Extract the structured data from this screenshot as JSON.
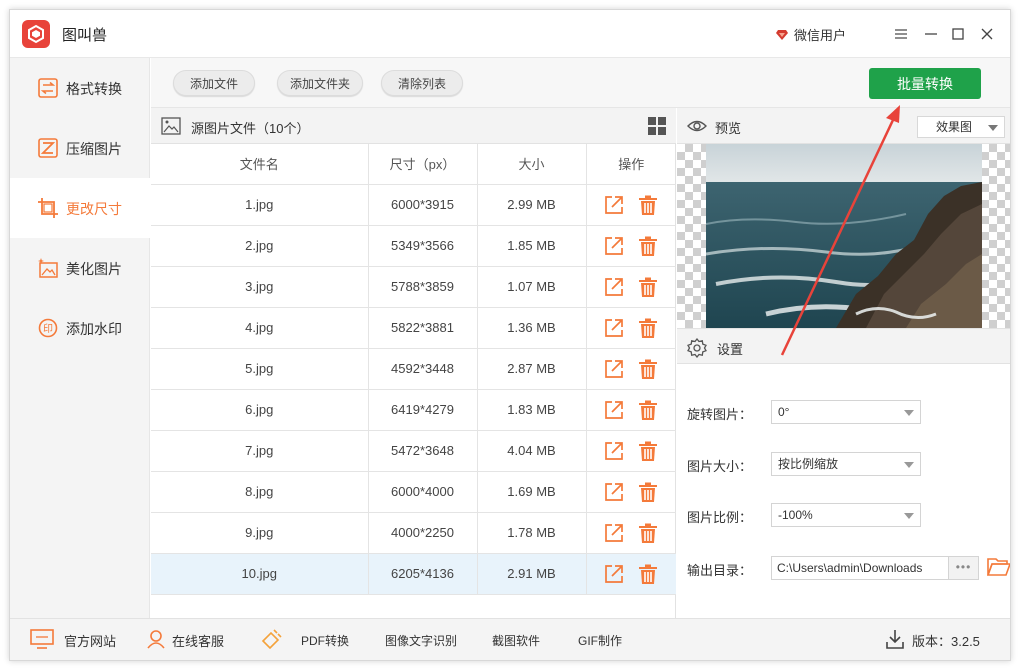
{
  "app": {
    "title": "图叫兽",
    "user_label": "微信用户"
  },
  "window_controls": {
    "menu": "☰",
    "minimize": "—",
    "maximize": "☐",
    "close": "✕"
  },
  "sidebar": {
    "items": [
      {
        "label": "格式转换",
        "icon": "swap-icon"
      },
      {
        "label": "压缩图片",
        "icon": "compress-icon"
      },
      {
        "label": "更改尺寸",
        "icon": "crop-icon",
        "active": true
      },
      {
        "label": "美化图片",
        "icon": "sparkle-image-icon"
      },
      {
        "label": "添加水印",
        "icon": "stamp-icon"
      }
    ]
  },
  "toolbar": {
    "add_file": "添加文件",
    "add_folder": "添加文件夹",
    "clear_list": "清除列表",
    "batch_convert": "批量转换"
  },
  "file_list": {
    "title": "源图片文件（10个）",
    "columns": [
      "文件名",
      "尺寸（px）",
      "大小",
      "操作"
    ],
    "rows": [
      {
        "name": "1.jpg",
        "size_px": "6000*3915",
        "filesize": "2.99 MB"
      },
      {
        "name": "2.jpg",
        "size_px": "5349*3566",
        "filesize": "1.85 MB"
      },
      {
        "name": "3.jpg",
        "size_px": "5788*3859",
        "filesize": "1.07 MB"
      },
      {
        "name": "4.jpg",
        "size_px": "5822*3881",
        "filesize": "1.36 MB"
      },
      {
        "name": "5.jpg",
        "size_px": "4592*3448",
        "filesize": "2.87 MB"
      },
      {
        "name": "6.jpg",
        "size_px": "6419*4279",
        "filesize": "1.83 MB"
      },
      {
        "name": "7.jpg",
        "size_px": "5472*3648",
        "filesize": "4.04 MB"
      },
      {
        "name": "8.jpg",
        "size_px": "6000*4000",
        "filesize": "1.69 MB"
      },
      {
        "name": "9.jpg",
        "size_px": "4000*2250",
        "filesize": "1.78 MB"
      },
      {
        "name": "10.jpg",
        "size_px": "6205*4136",
        "filesize": "2.91 MB",
        "selected": true
      }
    ]
  },
  "preview": {
    "title": "预览",
    "mode": "效果图"
  },
  "settings": {
    "title": "设置",
    "rotate_label": "旋转图片：",
    "rotate_value": "0°",
    "size_label": "图片大小：",
    "size_value": "按比例缩放",
    "ratio_label": "图片比例：",
    "ratio_value": "-100%",
    "output_label": "输出目录：",
    "output_value": "C:\\Users\\admin\\Downloads",
    "browse": "•••"
  },
  "bottom": {
    "website": "官方网站",
    "support": "在线客服",
    "pdf": "PDF转换",
    "ocr": "图像文字识别",
    "screenshot": "截图软件",
    "gif": "GIF制作",
    "version": "版本：3.2.5"
  },
  "colors": {
    "accent": "#f47a3a",
    "primary_green": "#1fa24a",
    "annotation_red": "#e8433a"
  }
}
